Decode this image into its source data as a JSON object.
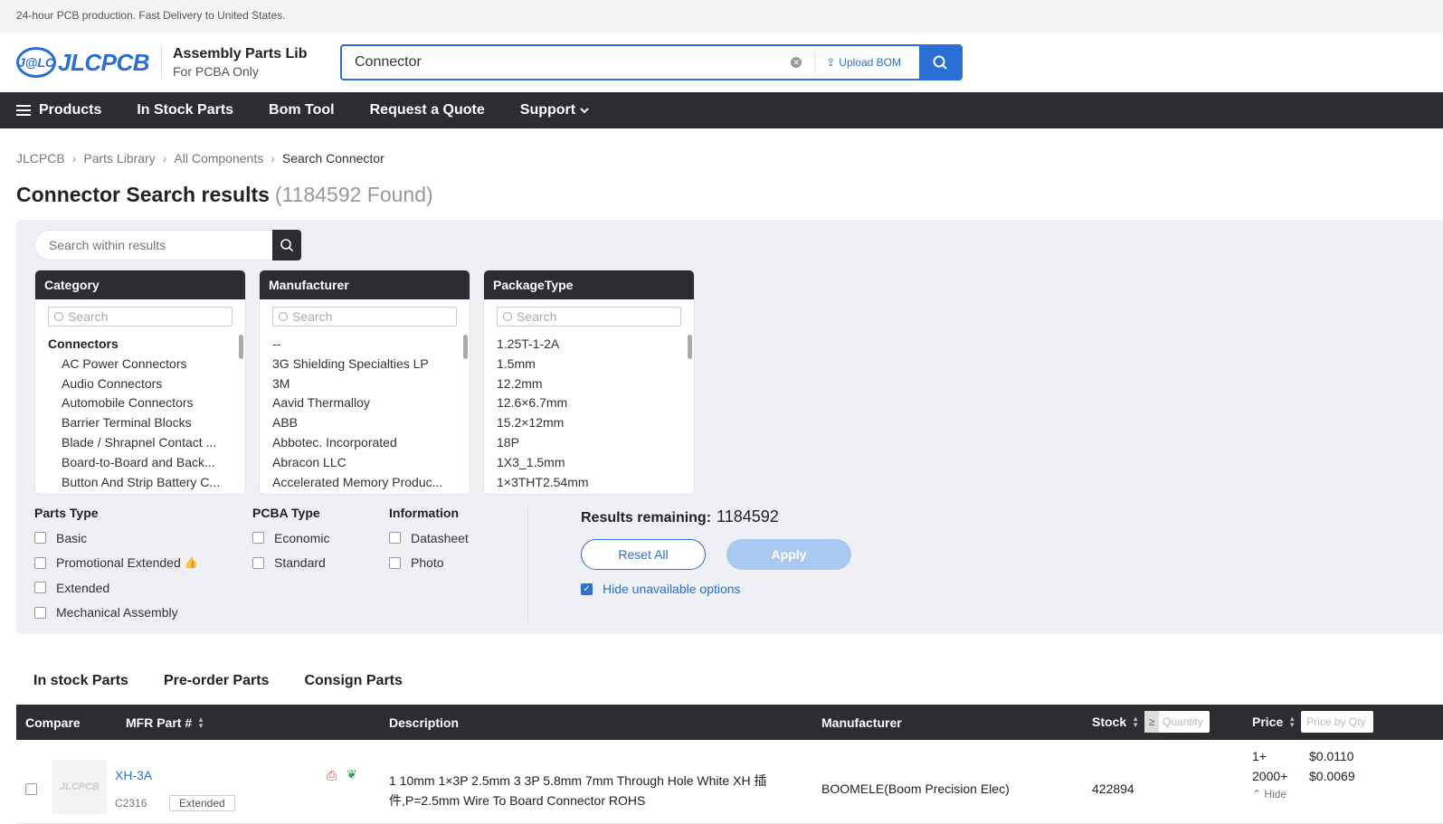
{
  "topbar": {
    "text": "24-hour PCB production. Fast Delivery to United States."
  },
  "header": {
    "logo_badge": "J@LC",
    "logo_text": "JLCPCB",
    "lib_title": "Assembly Parts Lib",
    "lib_subtitle": "For PCBA Only",
    "search_value": "Connector",
    "upload_bom": "Upload BOM"
  },
  "nav": {
    "products": "Products",
    "in_stock": "In Stock Parts",
    "bom_tool": "Bom Tool",
    "quote": "Request a Quote",
    "support": "Support"
  },
  "breadcrumb": [
    "JLCPCB",
    "Parts Library",
    "All Components",
    "Search Connector"
  ],
  "page": {
    "title": "Connector Search results",
    "found": "(1184592 Found)"
  },
  "filters": {
    "within_placeholder": "Search within results",
    "search_placeholder": "Search",
    "category": {
      "title": "Category",
      "head": "Connectors",
      "items": [
        "AC Power Connectors",
        "Audio Connectors",
        "Automobile Connectors",
        "Barrier Terminal Blocks",
        "Blade / Shrapnel Contact ...",
        "Board-to-Board and Back...",
        "Button And Strip Battery C..."
      ]
    },
    "manufacturer": {
      "title": "Manufacturer",
      "items": [
        "--",
        "3G Shielding Specialties LP",
        "3M",
        "Aavid Thermalloy",
        "ABB",
        "Abbotec. Incorporated",
        "Abracon LLC",
        "Accelerated Memory Produc..."
      ]
    },
    "package": {
      "title": "PackageType",
      "items": [
        "1.25T-1-2A",
        "1.5mm",
        "12.2mm",
        "12.6×6.7mm",
        "15.2×12mm",
        "18P",
        "1X3_1.5mm",
        "1×3THT2.54mm"
      ]
    },
    "parts_type": {
      "title": "Parts Type",
      "options": [
        "Basic",
        "Promotional Extended",
        "Extended",
        "Mechanical Assembly"
      ]
    },
    "pcba_type": {
      "title": "PCBA Type",
      "options": [
        "Economic",
        "Standard"
      ]
    },
    "information": {
      "title": "Information",
      "options": [
        "Datasheet",
        "Photo"
      ]
    },
    "results_label": "Results remaining:",
    "results_count": "1184592",
    "reset_label": "Reset All",
    "apply_label": "Apply",
    "hide_unavailable": "Hide unavailable options"
  },
  "tabs": [
    "In stock Parts",
    "Pre-order Parts",
    "Consign Parts"
  ],
  "table": {
    "headers": {
      "compare": "Compare",
      "mfr_part": "MFR Part #",
      "description": "Description",
      "manufacturer": "Manufacturer",
      "stock": "Stock",
      "qty_placeholder": "Quantity",
      "price": "Price",
      "price_placeholder": "Price by Qty"
    },
    "rows": [
      {
        "thumb_text": "JLCPCB",
        "part": "XH-3A",
        "code": "C2316",
        "tag": "Extended",
        "description": "1 10mm 1×3P 2.5mm 3 3P 5.8mm 7mm Through Hole White XH 插件,P=2.5mm Wire To Board Connector ROHS",
        "manufacturer": "BOOMELE(Boom Precision Elec)",
        "stock": "422894",
        "prices": [
          {
            "q": "1+",
            "p": "$0.0110"
          },
          {
            "q": "2000+",
            "p": "$0.0069"
          }
        ],
        "hide": "Hide"
      }
    ]
  },
  "colors": {
    "accent": "#2a6fd6",
    "dark": "#2b2d31",
    "panel": "#eef0f3"
  }
}
